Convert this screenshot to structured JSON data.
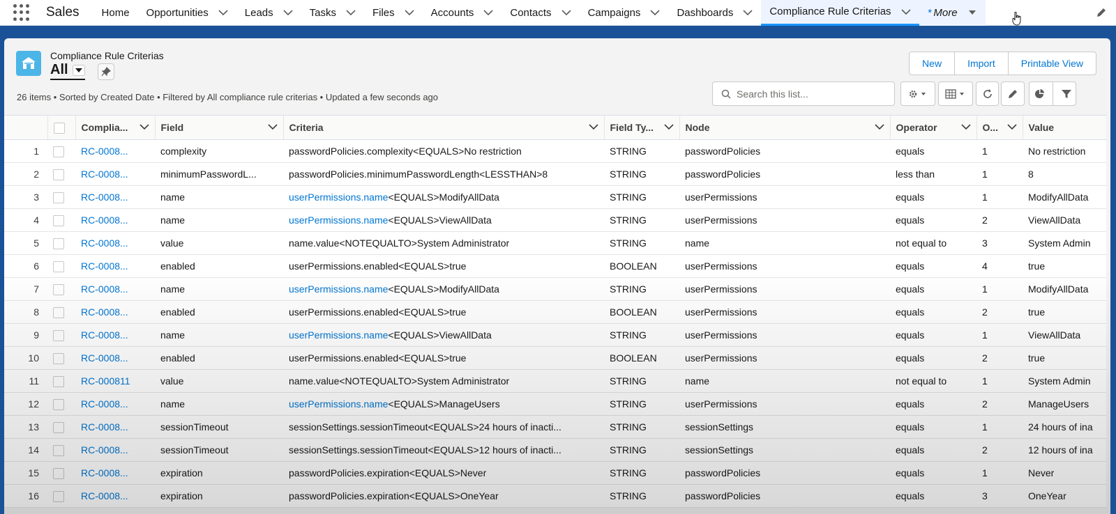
{
  "app": {
    "name": "Sales"
  },
  "nav": {
    "items": [
      {
        "label": "Home",
        "chevron": false
      },
      {
        "label": "Opportunities",
        "chevron": true
      },
      {
        "label": "Leads",
        "chevron": true
      },
      {
        "label": "Tasks",
        "chevron": true
      },
      {
        "label": "Files",
        "chevron": true
      },
      {
        "label": "Accounts",
        "chevron": true
      },
      {
        "label": "Contacts",
        "chevron": true
      },
      {
        "label": "Campaigns",
        "chevron": true
      },
      {
        "label": "Dashboards",
        "chevron": true
      },
      {
        "label": "Compliance Rule Criterias",
        "chevron": true,
        "active": true
      }
    ],
    "more_prefix": "*",
    "more_label": "More"
  },
  "header": {
    "object_label": "Compliance Rule Criterias",
    "view_name": "All",
    "icon": "compliance-object-icon",
    "accent": "#4bb5e8"
  },
  "buttons": {
    "new": "New",
    "import": "Import",
    "printable_view": "Printable View"
  },
  "meta_text": "26 items • Sorted by Created Date • Filtered by All compliance rule criterias • Updated a few seconds ago",
  "search": {
    "placeholder": "Search this list..."
  },
  "columns": [
    "Complia...",
    "Field",
    "Criteria",
    "Field Ty...",
    "Node",
    "Operator",
    "O...",
    "Value"
  ],
  "rows": [
    {
      "n": "1",
      "id": "RC-0008...",
      "field": "complexity",
      "crit_link": "",
      "crit_text": "passwordPolicies.complexity<EQUALS>No restriction",
      "type": "STRING",
      "node": "passwordPolicies",
      "op": "equals",
      "o": "1",
      "value": "No restriction"
    },
    {
      "n": "2",
      "id": "RC-0008...",
      "field": "minimumPasswordL...",
      "crit_link": "",
      "crit_text": "passwordPolicies.minimumPasswordLength<LESSTHAN>8",
      "type": "STRING",
      "node": "passwordPolicies",
      "op": "less than",
      "o": "1",
      "value": "8"
    },
    {
      "n": "3",
      "id": "RC-0008...",
      "field": "name",
      "crit_link": "userPermissions.name",
      "crit_text": "<EQUALS>ModifyAllData",
      "type": "STRING",
      "node": "userPermissions",
      "op": "equals",
      "o": "1",
      "value": "ModifyAllData"
    },
    {
      "n": "4",
      "id": "RC-0008...",
      "field": "name",
      "crit_link": "userPermissions.name",
      "crit_text": "<EQUALS>ViewAllData",
      "type": "STRING",
      "node": "userPermissions",
      "op": "equals",
      "o": "2",
      "value": "ViewAllData"
    },
    {
      "n": "5",
      "id": "RC-0008...",
      "field": "value",
      "crit_link": "",
      "crit_text": "name.value<NOTEQUALTO>System Administrator",
      "type": "STRING",
      "node": "name",
      "op": "not equal to",
      "o": "3",
      "value": "System Admin"
    },
    {
      "n": "6",
      "id": "RC-0008...",
      "field": "enabled",
      "crit_link": "",
      "crit_text": "userPermissions.enabled<EQUALS>true",
      "type": "BOOLEAN",
      "node": "userPermissions",
      "op": "equals",
      "o": "4",
      "value": "true"
    },
    {
      "n": "7",
      "id": "RC-0008...",
      "field": "name",
      "crit_link": "userPermissions.name",
      "crit_text": "<EQUALS>ModifyAllData",
      "type": "STRING",
      "node": "userPermissions",
      "op": "equals",
      "o": "1",
      "value": "ModifyAllData"
    },
    {
      "n": "8",
      "id": "RC-0008...",
      "field": "enabled",
      "crit_link": "",
      "crit_text": "userPermissions.enabled<EQUALS>true",
      "type": "BOOLEAN",
      "node": "userPermissions",
      "op": "equals",
      "o": "2",
      "value": "true"
    },
    {
      "n": "9",
      "id": "RC-0008...",
      "field": "name",
      "crit_link": "userPermissions.name",
      "crit_text": "<EQUALS>ViewAllData",
      "type": "STRING",
      "node": "userPermissions",
      "op": "equals",
      "o": "1",
      "value": "ViewAllData"
    },
    {
      "n": "10",
      "id": "RC-0008...",
      "field": "enabled",
      "crit_link": "",
      "crit_text": "userPermissions.enabled<EQUALS>true",
      "type": "BOOLEAN",
      "node": "userPermissions",
      "op": "equals",
      "o": "2",
      "value": "true"
    },
    {
      "n": "11",
      "id": "RC-000811",
      "field": "value",
      "crit_link": "",
      "crit_text": "name.value<NOTEQUALTO>System Administrator",
      "type": "STRING",
      "node": "name",
      "op": "not equal to",
      "o": "1",
      "value": "System Admin"
    },
    {
      "n": "12",
      "id": "RC-0008...",
      "field": "name",
      "crit_link": "userPermissions.name",
      "crit_text": "<EQUALS>ManageUsers",
      "type": "STRING",
      "node": "userPermissions",
      "op": "equals",
      "o": "2",
      "value": "ManageUsers"
    },
    {
      "n": "13",
      "id": "RC-0008...",
      "field": "sessionTimeout",
      "crit_link": "",
      "crit_text": "sessionSettings.sessionTimeout<EQUALS>24 hours of inacti...",
      "type": "STRING",
      "node": "sessionSettings",
      "op": "equals",
      "o": "1",
      "value": "24 hours of ina"
    },
    {
      "n": "14",
      "id": "RC-0008...",
      "field": "sessionTimeout",
      "crit_link": "",
      "crit_text": "sessionSettings.sessionTimeout<EQUALS>12 hours of inacti...",
      "type": "STRING",
      "node": "sessionSettings",
      "op": "equals",
      "o": "2",
      "value": "12 hours of ina"
    },
    {
      "n": "15",
      "id": "RC-0008...",
      "field": "expiration",
      "crit_link": "",
      "crit_text": "passwordPolicies.expiration<EQUALS>Never",
      "type": "STRING",
      "node": "passwordPolicies",
      "op": "equals",
      "o": "1",
      "value": "Never"
    },
    {
      "n": "16",
      "id": "RC-0008...",
      "field": "expiration",
      "crit_link": "",
      "crit_text": "passwordPolicies.expiration<EQUALS>OneYear",
      "type": "STRING",
      "node": "passwordPolicies",
      "op": "equals",
      "o": "3",
      "value": "OneYear"
    }
  ],
  "colors": {
    "brand_blue": "#1b5297",
    "link": "#0176d3",
    "active_tab": "#1b96ff"
  }
}
